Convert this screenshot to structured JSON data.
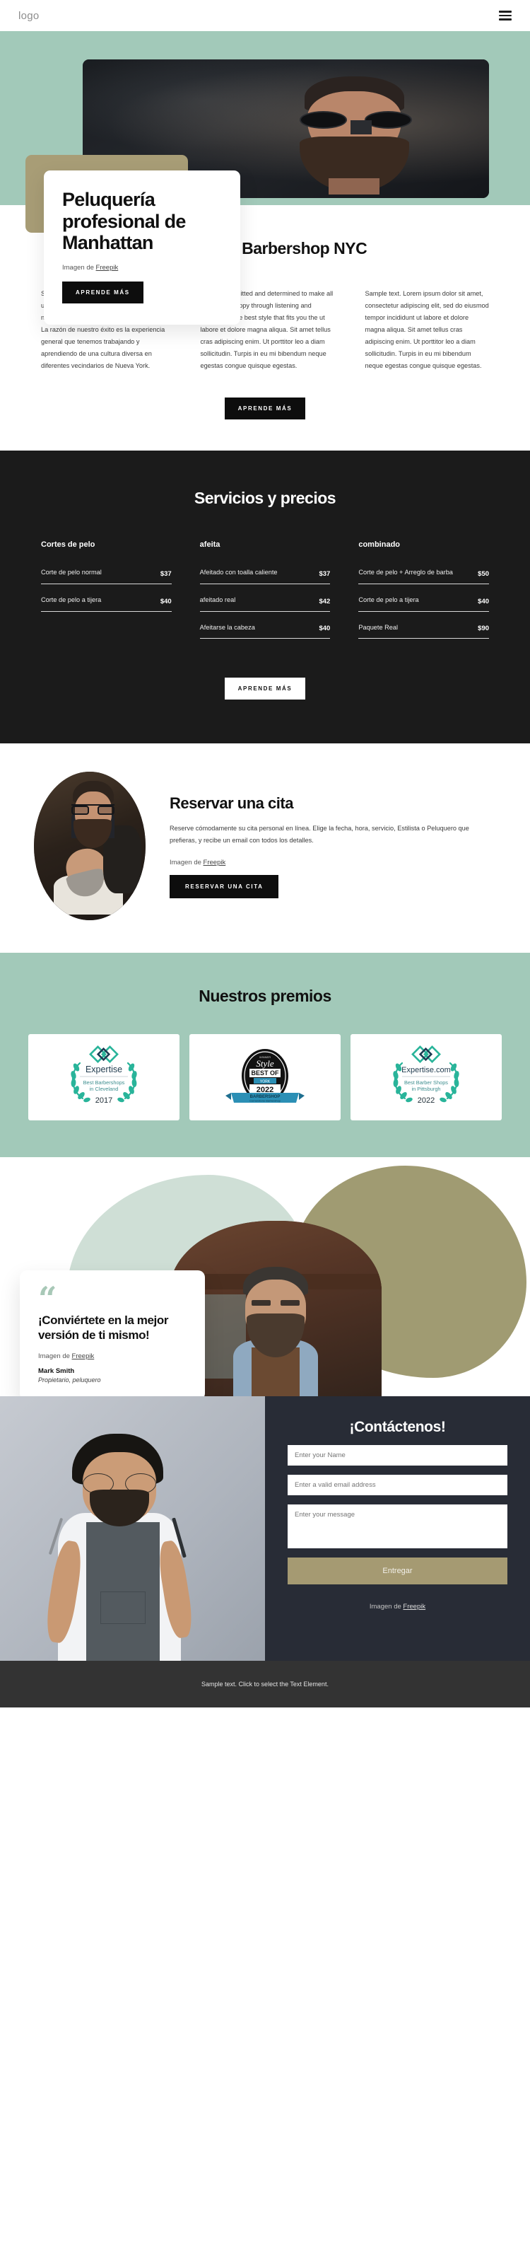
{
  "header": {
    "logo": "logo",
    "menu_icon": "hamburger-icon"
  },
  "hero": {
    "title": "Peluquería profesional de Manhattan",
    "credit_prefix": "Imagen de ",
    "credit_link": "Freepik",
    "cta": "APRENDE MÁS"
  },
  "about": {
    "heading": "Acerca de Barbershop NYC",
    "columns": [
      "Somos barberos de tercera generación con una experiencia y conocimientos de alto nivel en todos los aspectos de nuestro oficio. La razón de nuestro éxito es la experiencia general que tenemos trabajando y aprendiendo de una cultura diversa en diferentes vecindarios de Nueva York.",
      "We are committed and determined to make all our clients happy through listening and suggesting the best style that fits you the ut labore et dolore magna aliqua. Sit amet tellus cras adipiscing enim. Ut porttitor leo a diam sollicitudin. Turpis in eu mi bibendum neque egestas congue quisque egestas.",
      "Sample text. Lorem ipsum dolor sit amet, consectetur adipiscing elit, sed do eiusmod tempor incididunt ut labore et dolore magna aliqua. Sit amet tellus cras adipiscing enim. Ut porttitor leo a diam sollicitudin. Turpis in eu mi bibendum neque egestas congue quisque egestas."
    ],
    "cta": "APRENDE MÁS"
  },
  "services": {
    "heading": "Servicios y precios",
    "cta": "APRENDE MÁS",
    "groups": [
      {
        "title": "Cortes de pelo",
        "items": [
          {
            "name": "Corte de pelo normal",
            "price": "$37"
          },
          {
            "name": "Corte de pelo a tijera",
            "price": "$40"
          }
        ]
      },
      {
        "title": "afeita",
        "items": [
          {
            "name": "Afeitado con toalla caliente",
            "price": "$37"
          },
          {
            "name": "afeitado real",
            "price": "$42"
          },
          {
            "name": "Afeitarse la cabeza",
            "price": "$40"
          }
        ]
      },
      {
        "title": "combinado",
        "items": [
          {
            "name": "Corte de pelo + Arreglo de barba",
            "price": "$50"
          },
          {
            "name": "Corte de pelo a tijera",
            "price": "$40"
          },
          {
            "name": "Paquete Real",
            "price": "$90"
          }
        ]
      }
    ]
  },
  "booking": {
    "title": "Reservar una cita",
    "description": "Reserve cómodamente su cita personal en línea. Elige la fecha, hora, servicio, Estilista o Peluquero que prefieras, y recibe un email con todos los detalles.",
    "credit_prefix": "Imagen de ",
    "credit_link": "Freepik",
    "cta": "RESERVAR UNA CITA"
  },
  "awards": {
    "heading": "Nuestros premios",
    "items": [
      {
        "brand": "Expertise",
        "line1": "Best Barbershops",
        "line2": "in Cleveland",
        "year": "2017",
        "style": "laurel"
      },
      {
        "brand": "Style",
        "line1": "BEST OF",
        "line2": "YORK",
        "year": "2022",
        "ribbon1": "BARBERSHOP",
        "ribbon2": "Cornerstone Barbershop",
        "style": "seal"
      },
      {
        "brand": "Expertise.com",
        "line1": "Best Barber Shops",
        "line2": "in Pittsburgh",
        "year": "2022",
        "style": "laurel"
      }
    ]
  },
  "testimonial": {
    "quote_mark": "“",
    "quote": "¡Conviértete en la mejor versión de ti mismo!",
    "credit_prefix": "Imagen de ",
    "credit_link": "Freepik",
    "author": "Mark Smith",
    "role": "Propietario, peluquero"
  },
  "contact": {
    "title": "¡Contáctenos!",
    "name_placeholder": "Enter your Name",
    "email_placeholder": "Enter a valid email address",
    "message_placeholder": "Enter your message",
    "submit": "Entregar",
    "credit_prefix": "Imagen de ",
    "credit_link": "Freepik"
  },
  "footer": {
    "text": "Sample text. Click to select the Text Element."
  },
  "colors": {
    "sage": "#a2c9b9",
    "khaki": "#a89d76",
    "dark": "#1b1b1b",
    "navy": "#282c36",
    "gold": "#a59a72",
    "teal": "#29b49a"
  }
}
